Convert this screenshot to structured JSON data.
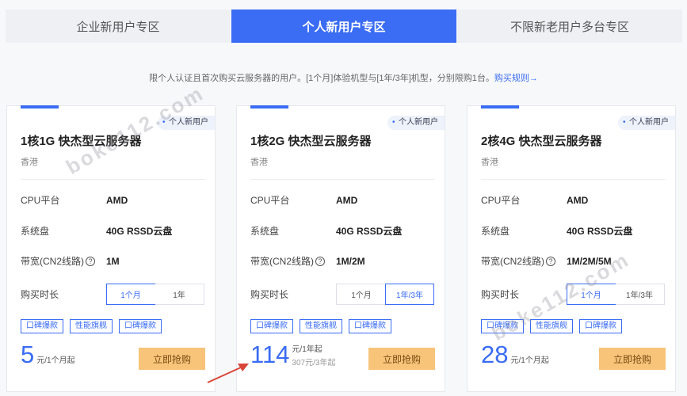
{
  "tabs": [
    "企业新用户专区",
    "个人新用户专区",
    "不限新老用户多台专区"
  ],
  "notice": {
    "text": "限个人认证且首次购买云服务器的用户。[1个月]体验机型与[1年/3年]机型，分别限购1台。",
    "link": "购买规则→"
  },
  "labels": {
    "cpu": "CPU平台",
    "disk": "系统盘",
    "bandwidth": "带宽(CN2线路)",
    "duration": "购买时长",
    "help": "?"
  },
  "cards": [
    {
      "badge": "个人新用户",
      "name": "1核1G 快杰型云服务器",
      "region": "香港",
      "cpu": "AMD",
      "disk": "40G RSSD云盘",
      "bandwidth": "1M",
      "durations": [
        "1个月",
        "1年"
      ],
      "selected": 0,
      "tags": [
        "口碑爆款",
        "性能旗舰",
        "口碑爆款"
      ],
      "price": "5",
      "price_unit": "元/1个月起",
      "price_sub": "",
      "buy": "立即抢购"
    },
    {
      "badge": "个人新用户",
      "name": "1核2G 快杰型云服务器",
      "region": "香港",
      "cpu": "AMD",
      "disk": "40G RSSD云盘",
      "bandwidth": "1M/2M",
      "durations": [
        "1个月",
        "1年/3年"
      ],
      "selected": 1,
      "tags": [
        "口碑爆款",
        "性能旗舰",
        "口碑爆款"
      ],
      "price": "114",
      "price_unit": "元/1年起",
      "price_sub": "307元/3年起",
      "buy": "立即抢购"
    },
    {
      "badge": "个人新用户",
      "name": "2核4G 快杰型云服务器",
      "region": "香港",
      "cpu": "AMD",
      "disk": "40G RSSD云盘",
      "bandwidth": "1M/2M/5M",
      "durations": [
        "1个月",
        "1年/3年"
      ],
      "selected": 0,
      "tags": [
        "口碑爆款",
        "性能旗舰",
        "口碑爆款"
      ],
      "price": "28",
      "price_unit": "元/1个月起",
      "price_sub": "",
      "buy": "立即抢购"
    }
  ],
  "watermark": "boke112.com",
  "colors": {
    "accent": "#3a6cf4",
    "buy": "#f7c47a",
    "arrow": "#d9453a"
  }
}
